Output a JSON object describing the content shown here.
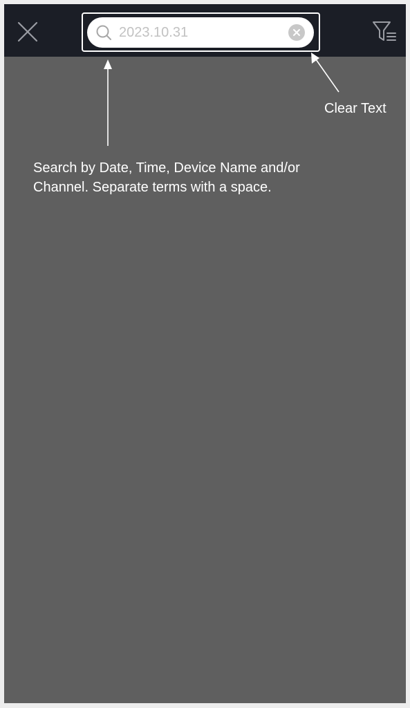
{
  "header": {
    "close_icon": "close-icon",
    "filter_icon": "filter-icon"
  },
  "search": {
    "value": "2023.10.31",
    "search_icon": "search-icon",
    "clear_icon": "clear-circle-icon"
  },
  "annotations": {
    "clear_text": "Clear Text",
    "search_hint": "Search by Date, Time, Device Name and/or Channel. Separate terms with a space."
  },
  "colors": {
    "topbar": "#1b1e26",
    "overlay": "#5f5f5f",
    "annotation_text": "#ffffff"
  }
}
